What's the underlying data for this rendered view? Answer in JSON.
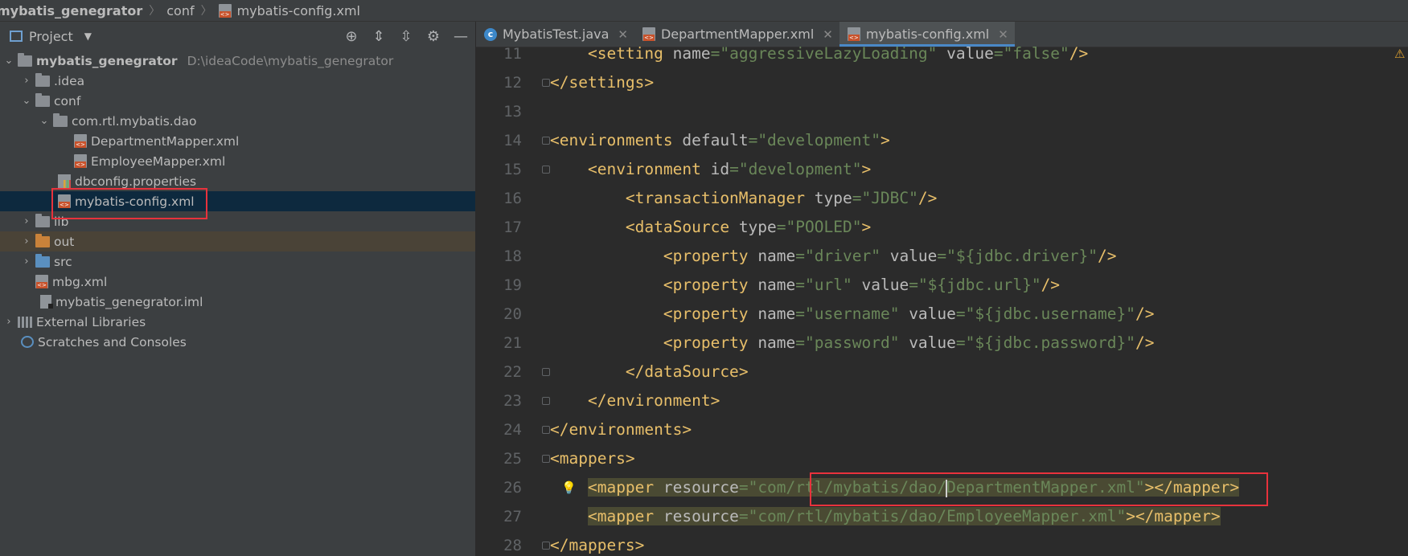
{
  "breadcrumb": [
    "mybatis_genegrator",
    "conf",
    "mybatis-config.xml"
  ],
  "panel": {
    "title": "Project",
    "tool_icons": [
      "locate-icon",
      "expand-all-icon",
      "collapse-all-icon",
      "gear-icon",
      "minimize-icon"
    ]
  },
  "tree": [
    {
      "label": "mybatis_genegrator",
      "path": "D:\\ideaCode\\mybatis_genegrator",
      "icon": "folder-icon",
      "expanded": true
    },
    {
      "label": ".idea",
      "icon": "folder-icon",
      "expanded": false
    },
    {
      "label": "conf",
      "icon": "folder-icon",
      "expanded": true
    },
    {
      "label": "com.rtl.mybatis.dao",
      "icon": "folder-icon",
      "expanded": true
    },
    {
      "label": "DepartmentMapper.xml",
      "icon": "xml-file-icon"
    },
    {
      "label": "EmployeeMapper.xml",
      "icon": "xml-file-icon"
    },
    {
      "label": "dbconfig.properties",
      "icon": "properties-file-icon"
    },
    {
      "label": "mybatis-config.xml",
      "icon": "xml-file-icon",
      "selected": true
    },
    {
      "label": "lib",
      "icon": "folder-icon",
      "expanded": false
    },
    {
      "label": "out",
      "icon": "folder-icon",
      "expanded": false
    },
    {
      "label": "src",
      "icon": "folder-icon",
      "expanded": false
    },
    {
      "label": "mbg.xml",
      "icon": "xml-file-icon"
    },
    {
      "label": "mybatis_genegrator.iml",
      "icon": "iml-file-icon"
    },
    {
      "label": "External Libraries",
      "icon": "library-icon",
      "expanded": false
    },
    {
      "label": "Scratches and Consoles",
      "icon": "scratches-icon"
    }
  ],
  "tabs": [
    {
      "label": "MybatisTest.java",
      "icon": "java-class-icon",
      "active": false
    },
    {
      "label": "DepartmentMapper.xml",
      "icon": "xml-file-icon",
      "active": false
    },
    {
      "label": "mybatis-config.xml",
      "icon": "xml-file-icon",
      "active": true
    }
  ],
  "code_lines": [
    {
      "n": "11",
      "text": "    <setting name=\"aggressiveLazyLoading\" value=\"false\"/>"
    },
    {
      "n": "12",
      "text": "</settings>"
    },
    {
      "n": "13",
      "text": ""
    },
    {
      "n": "14",
      "text": "<environments default=\"development\">"
    },
    {
      "n": "15",
      "text": "    <environment id=\"development\">"
    },
    {
      "n": "16",
      "text": "        <transactionManager type=\"JDBC\"/>"
    },
    {
      "n": "17",
      "text": "        <dataSource type=\"POOLED\">"
    },
    {
      "n": "18",
      "text": "            <property name=\"driver\" value=\"${jdbc.driver}\"/>"
    },
    {
      "n": "19",
      "text": "            <property name=\"url\" value=\"${jdbc.url}\"/>"
    },
    {
      "n": "20",
      "text": "            <property name=\"username\" value=\"${jdbc.username}\"/>"
    },
    {
      "n": "21",
      "text": "            <property name=\"password\" value=\"${jdbc.password}\"/>"
    },
    {
      "n": "22",
      "text": "        </dataSource>"
    },
    {
      "n": "23",
      "text": "    </environment>"
    },
    {
      "n": "24",
      "text": "</environments>"
    },
    {
      "n": "25",
      "text": "<mappers>"
    },
    {
      "n": "26",
      "text": "    <mapper resource=\"com/rtl/mybatis/dao/DepartmentMapper.xml\"></mapper>"
    },
    {
      "n": "27",
      "text": "    <mapper resource=\"com/rtl/mybatis/dao/EmployeeMapper.xml\"></mapper>"
    },
    {
      "n": "28",
      "text": "</mappers>"
    }
  ],
  "colors": {
    "tag": "#e8bf6a",
    "attribute": "#bababa",
    "value": "#6a8759",
    "selection": "#0d293e",
    "annotation_box": "#e8323c",
    "tab_underline": "#4a88c7"
  }
}
